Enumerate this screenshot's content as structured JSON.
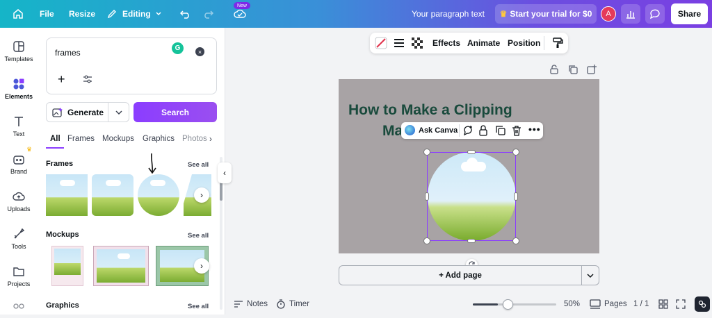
{
  "topbar": {
    "file": "File",
    "resize": "Resize",
    "editing": "Editing",
    "new_badge": "New",
    "doc_title": "Your paragraph text",
    "trial": "Start your trial for $0",
    "avatar": "A",
    "share": "Share"
  },
  "rail": [
    {
      "label": "Templates",
      "icon": "templates-icon"
    },
    {
      "label": "Elements",
      "icon": "elements-icon"
    },
    {
      "label": "Text",
      "icon": "text-icon"
    },
    {
      "label": "Brand",
      "icon": "brand-icon"
    },
    {
      "label": "Uploads",
      "icon": "uploads-icon"
    },
    {
      "label": "Tools",
      "icon": "tools-icon"
    },
    {
      "label": "Projects",
      "icon": "projects-icon"
    }
  ],
  "panel": {
    "search_value": "frames",
    "generate": "Generate",
    "search": "Search",
    "tabs": [
      "All",
      "Frames",
      "Mockups",
      "Graphics",
      "Photos"
    ],
    "sections": {
      "frames": "Frames",
      "mockups": "Mockups",
      "graphics": "Graphics",
      "see_all": "See all"
    }
  },
  "toolbar": {
    "effects": "Effects",
    "animate": "Animate",
    "position": "Position"
  },
  "canvas": {
    "title_line1": "How to Make a Clipping",
    "title_line2": "Ma",
    "ask_canva": "Ask Canva"
  },
  "add_page": "+ Add page",
  "bottombar": {
    "notes": "Notes",
    "timer": "Timer",
    "zoom": "50%",
    "zoom_level": 0.5,
    "pages": "Pages",
    "page_count": "1 / 1"
  },
  "colors": {
    "accent": "#8b3dff",
    "page_bg": "#a8a3a5",
    "title": "#194a3c"
  }
}
